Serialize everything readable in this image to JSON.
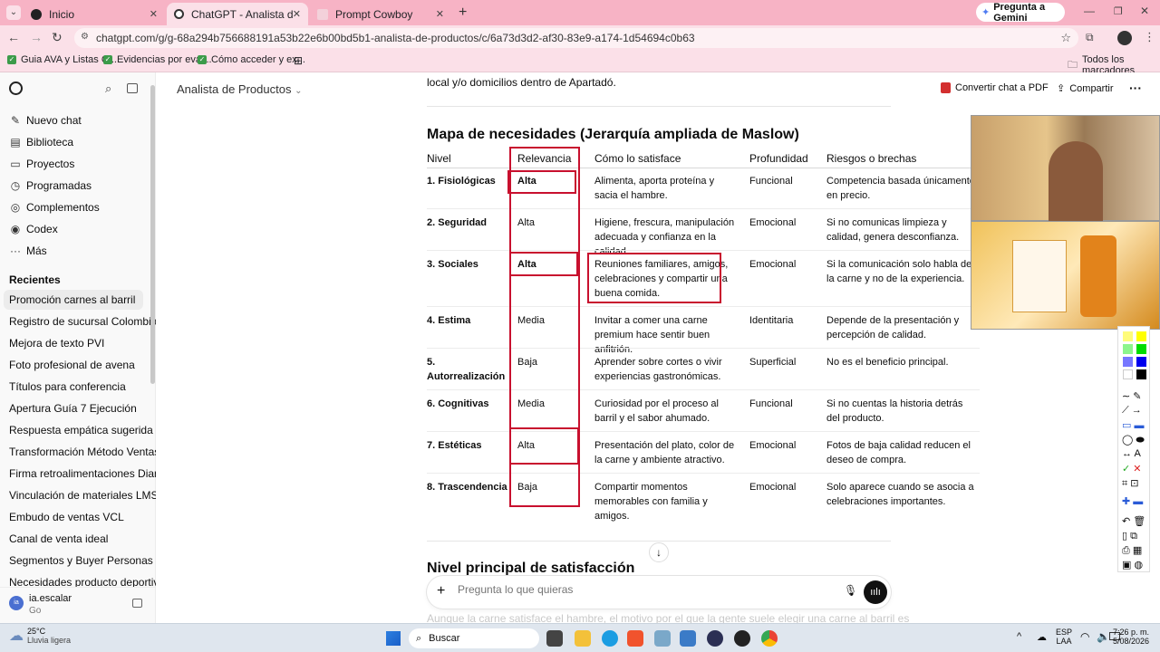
{
  "browser": {
    "tabs": [
      {
        "label": "Inicio",
        "active": false
      },
      {
        "label": "ChatGPT - Analista de Productos",
        "active": true
      },
      {
        "label": "Prompt Cowboy",
        "active": false
      }
    ],
    "gemini_button": "Pregunta a Gemini",
    "url": "chatgpt.com/g/g-68a294b756688191a53b22e6b00bd5b1-analista-de-productos/c/6a73d3d2-af30-83e9-a174-1d54694c0b63",
    "bookmarks": [
      "Guia AVA y Listas C...",
      "Evidencias por eval...",
      "Cómo acceder y ex..."
    ],
    "all_bookmarks": "Todos los marcadores"
  },
  "sidebar": {
    "nav": [
      {
        "label": "Nuevo chat",
        "icon": "edit-icon"
      },
      {
        "label": "Biblioteca",
        "icon": "library-icon"
      },
      {
        "label": "Proyectos",
        "icon": "folder-icon"
      },
      {
        "label": "Programadas",
        "icon": "clock-icon"
      },
      {
        "label": "Complementos",
        "icon": "plugin-icon"
      },
      {
        "label": "Codex",
        "icon": "codex-icon"
      },
      {
        "label": "Más",
        "icon": "more-icon"
      }
    ],
    "recent_heading": "Recientes",
    "recent": [
      "Promoción carnes al barril",
      "Registro de sucursal Colombia",
      "Mejora de texto PVI",
      "Foto profesional de avena",
      "Títulos para conferencia",
      "Apertura Guía 7 Ejecución",
      "Respuesta empática sugerida",
      "Transformación Método Ventas ...",
      "Firma retroalimentaciones Diana...",
      "Vinculación de materiales LMS",
      "Embudo de ventas VCL",
      "Canal de venta ideal",
      "Segmentos y Buyer Personas",
      "Necesidades producto deportivo"
    ],
    "user": {
      "initials": "ia",
      "name": "ia.escalar",
      "plan": "Go"
    }
  },
  "header": {
    "gpt_name": "Analista de Productos",
    "pdf_label": "Convertir chat a PDF",
    "share_label": "Compartir"
  },
  "content": {
    "intro_tail": "local y/o domicilios dentro de Apartadó.",
    "section_title": "Mapa de necesidades (Jerarquía ampliada de Maslow)",
    "table": {
      "headers": [
        "Nivel",
        "Relevancia",
        "Cómo lo satisface",
        "Profundidad",
        "Riesgos o brechas"
      ],
      "rows": [
        {
          "nivel": "1. Fisiológicas",
          "relevancia": "Alta",
          "como": "Alimenta, aporta proteína y sacia el hambre.",
          "profundidad": "Funcional",
          "riesgos": "Competencia basada únicamente en precio."
        },
        {
          "nivel": "2. Seguridad",
          "relevancia": "Alta",
          "como": "Higiene, frescura, manipulación adecuada y confianza en la calidad.",
          "profundidad": "Emocional",
          "riesgos": "Si no comunicas limpieza y calidad, genera desconfianza."
        },
        {
          "nivel": "3. Sociales",
          "relevancia": "Alta",
          "como": "Reuniones familiares, amigos, celebraciones y compartir una buena comida.",
          "profundidad": "Emocional",
          "riesgos": "Si la comunicación solo habla de la carne y no de la experiencia."
        },
        {
          "nivel": "4. Estima",
          "relevancia": "Media",
          "como": "Invitar a comer una carne premium hace sentir buen anfitrión.",
          "profundidad": "Identitaria",
          "riesgos": "Depende de la presentación y percepción de calidad."
        },
        {
          "nivel": "5. Autorrealización",
          "relevancia": "Baja",
          "como": "Aprender sobre cortes o vivir experiencias gastronómicas.",
          "profundidad": "Superficial",
          "riesgos": "No es el beneficio principal."
        },
        {
          "nivel": "6. Cognitivas",
          "relevancia": "Media",
          "como": "Curiosidad por el proceso al barril y el sabor ahumado.",
          "profundidad": "Funcional",
          "riesgos": "Si no cuentas la historia detrás del producto."
        },
        {
          "nivel": "7. Estéticas",
          "relevancia": "Alta",
          "como": "Presentación del plato, color de la carne y ambiente atractivo.",
          "profundidad": "Emocional",
          "riesgos": "Fotos de baja calidad reducen el deseo de compra."
        },
        {
          "nivel": "8. Trascendencia",
          "relevancia": "Baja",
          "como": "Compartir momentos memorables con familia y amigos.",
          "profundidad": "Emocional",
          "riesgos": "Solo aparece cuando se asocia a celebraciones importantes."
        }
      ]
    },
    "next_title": "Nivel principal de satisfacción",
    "faded_text": "Aunque la carne satisface el hambre, el motivo por el que la gente suele elegir una carne al barril es"
  },
  "composer": {
    "placeholder": "Pregunta lo que quieras"
  },
  "taskbar": {
    "weather_temp": "25°C",
    "weather_desc": "Lluvia ligera",
    "search_label": "Buscar",
    "lang": "ESP",
    "lang2": "LAA",
    "time": "7:26 p. m.",
    "date": "5/08/2026"
  },
  "colors": {
    "accent_red": "#c8102e",
    "tab_pink": "#f7b3c5"
  }
}
